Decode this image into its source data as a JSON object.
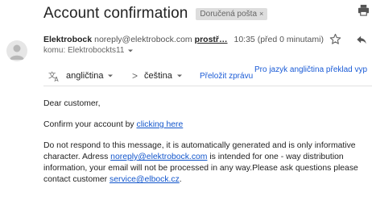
{
  "email": {
    "subject": "Account confirmation",
    "label": "Doručená pošta",
    "label_close": "×",
    "sender_name": "Elektrobock",
    "sender_email": "noreply@elektrobock.com",
    "sender_via": "prostř…",
    "time": "10:35 (před 0 minutami)",
    "to": "komu: Elektrobockts11"
  },
  "translate": {
    "source_lang": "angličtina",
    "arrow": ">",
    "target_lang": "čeština",
    "translate_link": "Přeložit zprávu",
    "always_translate": "Pro jazyk angličtina překlad vyp"
  },
  "body": {
    "greeting": "Dear customer,",
    "confirm_prefix": "Confirm your account by ",
    "confirm_link": "clicking here",
    "notice_part1": "Do not respond to this message, it is automatically generated and is only informative character. Adress ",
    "notice_link": "noreply@elektrobock.com",
    "notice_part2": " is intended for one - way distribution information, your email will not be processed in any way.Please ask questions please contact customer ",
    "service_link": "service@elbock.cz",
    "notice_end": "."
  },
  "icons": {
    "print": "printer-icon",
    "avatar": "avatar-icon",
    "star": "star-icon",
    "reply": "reply-icon",
    "translate": "translate-icon"
  }
}
